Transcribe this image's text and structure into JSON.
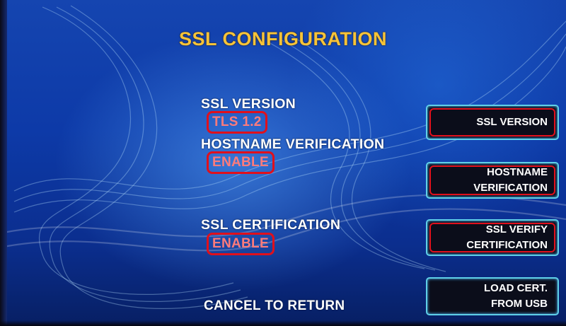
{
  "screen": {
    "title": "SSL CONFIGURATION",
    "cancel_text": "CANCEL TO RETURN"
  },
  "settings": [
    {
      "label": "SSL VERSION",
      "value": "TLS 1.2"
    },
    {
      "label": "HOSTNAME VERIFICATION",
      "value": "ENABLE"
    },
    {
      "label": "SSL CERTIFICATION",
      "value": "ENABLE"
    }
  ],
  "buttons": [
    {
      "label": "SSL VERSION",
      "highlighted": true
    },
    {
      "label": "HOSTNAME\nVERIFICATION",
      "highlighted": true
    },
    {
      "label": "SSL VERIFY\nCERTIFICATION",
      "highlighted": true
    },
    {
      "label": "LOAD CERT.\nFROM USB",
      "highlighted": false
    }
  ],
  "colors": {
    "title": "#f7c338",
    "value_text": "#ff7b7b",
    "highlight_ring": "#e0101c",
    "button_border": "#5fd0e8",
    "background": "#0d3aa8"
  }
}
